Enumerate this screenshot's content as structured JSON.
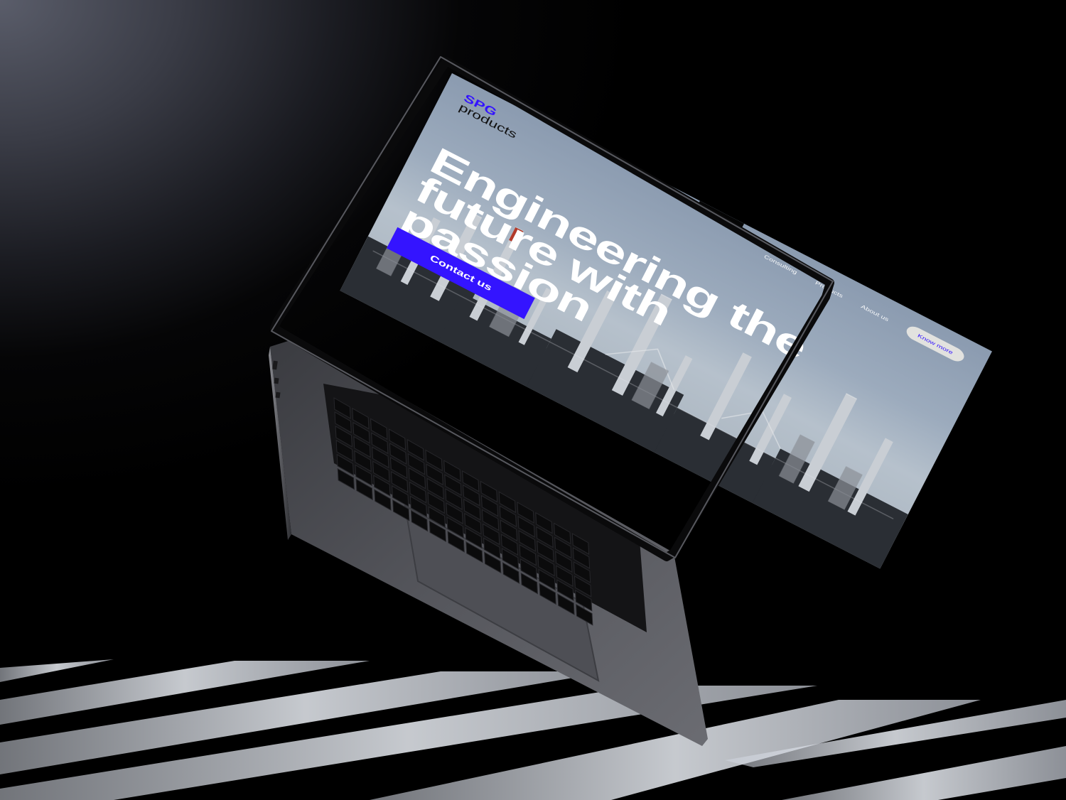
{
  "brand": {
    "line1": "SPG",
    "line2": "products",
    "accent_color": "#3414ff"
  },
  "nav": {
    "links": [
      "Consulting",
      "Products",
      "About us"
    ],
    "cta_label": "Know more"
  },
  "hero": {
    "title_lines": [
      "Engineering the",
      "future with",
      "passion"
    ],
    "button_label": "Contact us",
    "image": "industrial-refinery-photo"
  },
  "scene": {
    "device": "laptop-icon",
    "background_color": "#000000",
    "screen_sky_color": "#9cabbd"
  }
}
